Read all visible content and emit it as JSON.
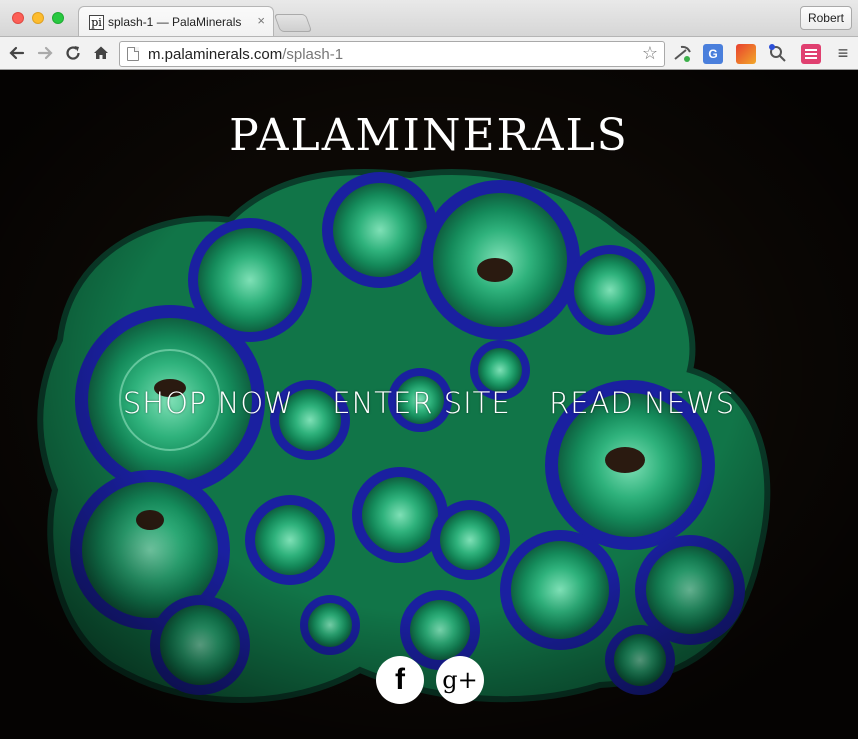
{
  "window": {
    "tab_title": "splash-1 — PalaMinerals",
    "tab_favicon_text": "pi",
    "tab_close_icon": "×",
    "profile_name": "Robert"
  },
  "toolbar": {
    "url_host": "m.palaminerals.com",
    "url_path": "/splash-1",
    "icons": [
      "back-arrow-icon",
      "forward-arrow-icon",
      "reload-icon",
      "home-icon",
      "bookmark-star-icon",
      "menu-icon"
    ],
    "extensions": [
      "pickaxe-extension",
      "google-translate-extension",
      "pdf-extension",
      "key-extension",
      "list-extension"
    ]
  },
  "page": {
    "brand": "PALAMINERALS",
    "links": [
      "SHOP NOW",
      "ENTER SITE",
      "READ NEWS"
    ],
    "social": {
      "facebook_glyph": "f",
      "google_plus_glyph": "g+"
    }
  },
  "colors": {
    "background": "#0c0805",
    "mineral_green": "#2db37a",
    "mineral_blue": "#1a1f9e",
    "text": "#ffffff"
  }
}
